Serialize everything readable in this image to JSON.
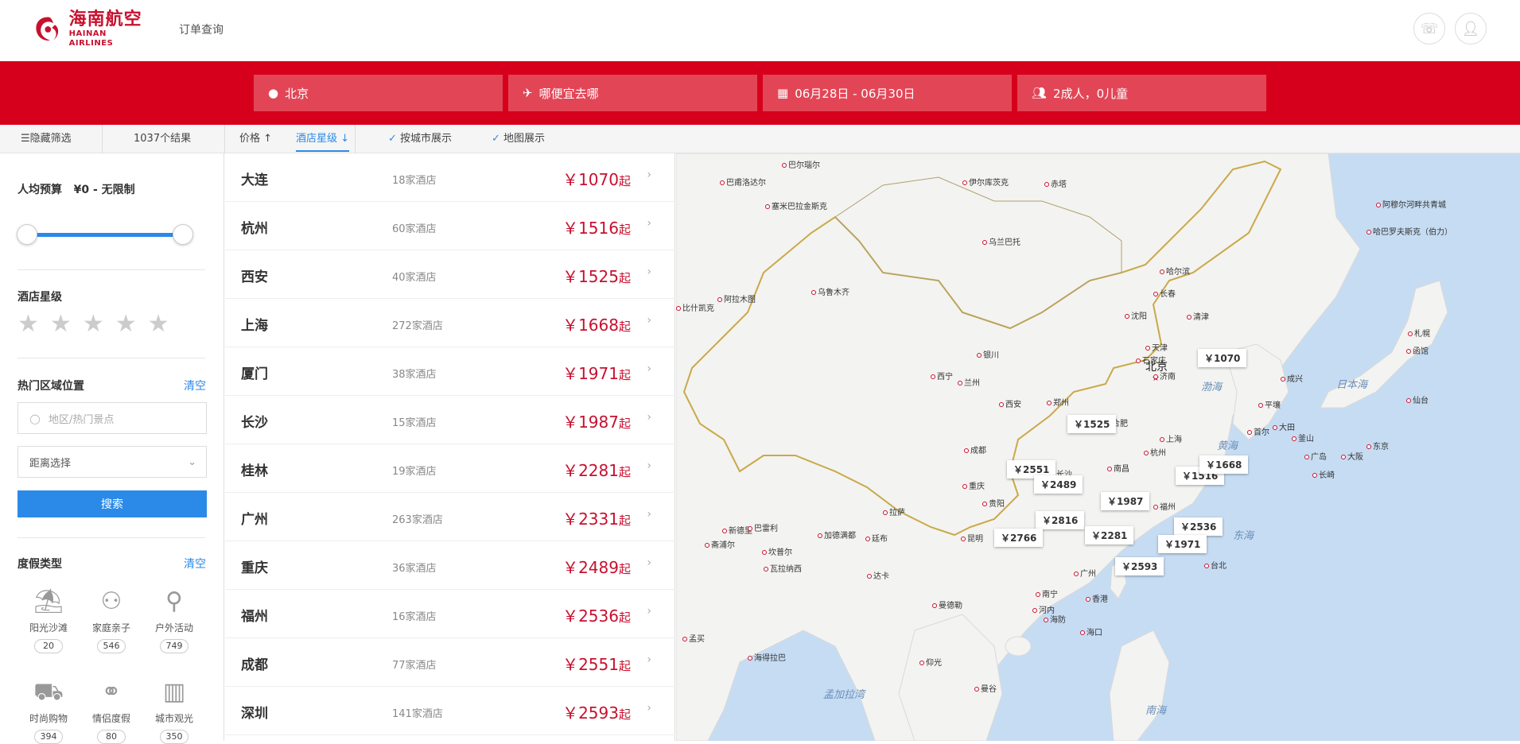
{
  "header": {
    "logo_cn": "海南航空",
    "logo_en": "HAINAN AIRLINES",
    "order_link": "订单查询",
    "phone_icon": "phone-icon",
    "user_icon": "user-icon"
  },
  "search": {
    "origin": "北京",
    "destination": "哪便宜去哪",
    "dates": "06月28日 - 06月30日",
    "guests": "2成人，0儿童"
  },
  "filters": {
    "hide_filter": "隐藏筛选",
    "result_count": "1037个结果",
    "sort_price": "价格 ↑",
    "sort_star": "酒店星级 ↓",
    "by_city": "按城市展示",
    "map_view": "地图展示"
  },
  "sidebar": {
    "budget_label": "人均预算",
    "budget_value": "¥0 - 无限制",
    "star_label": "酒店星级",
    "area_label": "热门区域位置",
    "area_clear": "清空",
    "area_placeholder": "地区/热门景点",
    "distance_select": "距离选择",
    "search_button": "搜索",
    "vacation_label": "度假类型",
    "vacation_clear": "清空",
    "vacation_types": [
      {
        "name": "阳光沙滩",
        "count": "20",
        "icon": "beach-icon"
      },
      {
        "name": "家庭亲子",
        "count": "546",
        "icon": "family-icon"
      },
      {
        "name": "户外活动",
        "count": "749",
        "icon": "bike-icon"
      },
      {
        "name": "时尚购物",
        "count": "394",
        "icon": "cart-icon"
      },
      {
        "name": "情侣度假",
        "count": "80",
        "icon": "couple-icon"
      },
      {
        "name": "城市观光",
        "count": "350",
        "icon": "city-icon"
      }
    ]
  },
  "list": [
    {
      "city": "大连",
      "hotels": "18家酒店",
      "price": "￥1070",
      "suffix": "起"
    },
    {
      "city": "杭州",
      "hotels": "60家酒店",
      "price": "￥1516",
      "suffix": "起"
    },
    {
      "city": "西安",
      "hotels": "40家酒店",
      "price": "￥1525",
      "suffix": "起"
    },
    {
      "city": "上海",
      "hotels": "272家酒店",
      "price": "￥1668",
      "suffix": "起"
    },
    {
      "city": "厦门",
      "hotels": "38家酒店",
      "price": "￥1971",
      "suffix": "起"
    },
    {
      "city": "长沙",
      "hotels": "15家酒店",
      "price": "￥1987",
      "suffix": "起"
    },
    {
      "city": "桂林",
      "hotels": "19家酒店",
      "price": "￥2281",
      "suffix": "起"
    },
    {
      "city": "广州",
      "hotels": "263家酒店",
      "price": "￥2331",
      "suffix": "起"
    },
    {
      "city": "重庆",
      "hotels": "36家酒店",
      "price": "￥2489",
      "suffix": "起"
    },
    {
      "city": "福州",
      "hotels": "16家酒店",
      "price": "￥2536",
      "suffix": "起"
    },
    {
      "city": "成都",
      "hotels": "77家酒店",
      "price": "￥2551",
      "suffix": "起"
    },
    {
      "city": "深圳",
      "hotels": "141家酒店",
      "price": "￥2593",
      "suffix": "起"
    }
  ],
  "map": {
    "beijing": "北京",
    "seas": [
      "渤海",
      "黄海",
      "东海",
      "日本海",
      "南海",
      "孟加拉湾"
    ],
    "cities": [
      "巴尔瑙尔",
      "巴甫洛达尔",
      "伊尔库茨克",
      "赤塔",
      "塞米巴拉金斯克",
      "乌兰巴托",
      "哈巴罗夫斯克（伯力）",
      "阿穆尔河畔共青城",
      "哈尔滨",
      "长春",
      "沈阳",
      "清津",
      "乌鲁木齐",
      "阿拉木图",
      "比什凯克",
      "银川",
      "天津",
      "石家庄",
      "济南",
      "西宁",
      "兰州",
      "西安",
      "郑州",
      "合肥",
      "上海",
      "杭州",
      "成都",
      "重庆",
      "长沙",
      "南昌",
      "贵阳",
      "昆明",
      "南宁",
      "广州",
      "香港",
      "福州",
      "台北",
      "拉萨",
      "加德满都",
      "廷布",
      "达卡",
      "曼德勒",
      "河内",
      "海防",
      "海口",
      "仰光",
      "曼谷",
      "新德里",
      "斋浦尔",
      "坎普尔",
      "巴雷利",
      "瓦拉纳西",
      "孟买",
      "海得拉巴",
      "札幌",
      "函馆",
      "仙台",
      "东京",
      "大阪",
      "广岛",
      "首尔",
      "平壤",
      "大田",
      "釜山",
      "长崎",
      "成兴"
    ],
    "prices": [
      "￥1070",
      "￥1525",
      "￥2551",
      "￥2489",
      "￥1987",
      "￥1516",
      "￥1668",
      "￥2816",
      "￥2766",
      "￥2281",
      "￥2536",
      "￥1971",
      "￥2593"
    ]
  },
  "colors": {
    "brand_red": "#d7001c",
    "accent_blue": "#2b8ae8",
    "price_red": "#c8102e"
  }
}
